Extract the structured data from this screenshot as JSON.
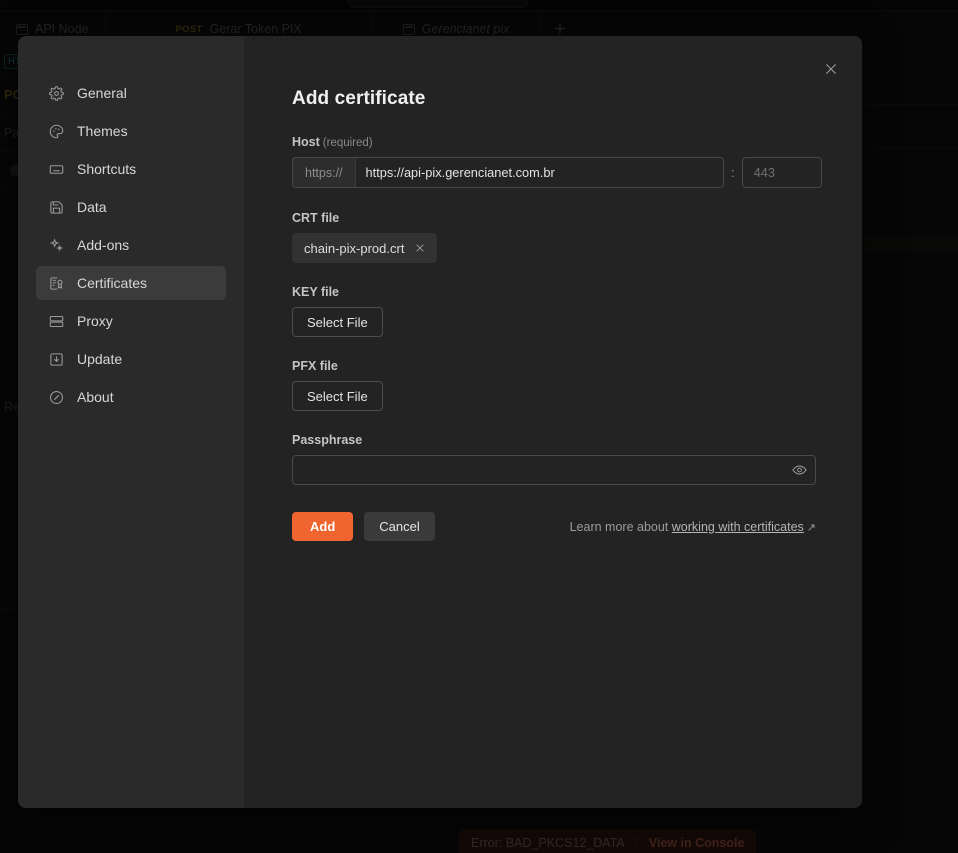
{
  "background": {
    "tabs": [
      {
        "label": "API Node",
        "method": "",
        "icon": "node-icon",
        "italic": false
      },
      {
        "label": "Gerar Token PIX",
        "method": "POST",
        "icon": "",
        "italic": false
      },
      {
        "label": "Gerencianet pix",
        "method": "",
        "icon": "node-icon",
        "italic": true
      }
    ],
    "new_tab_label": "+",
    "left_rows": [
      {
        "text": "HTTP",
        "kind": "badge"
      },
      {
        "text": "PO",
        "kind": "post"
      },
      {
        "text": "Para",
        "kind": "plain"
      },
      {
        "text": "",
        "kind": "dot"
      },
      {
        "text": "Res",
        "kind": "plain"
      }
    ],
    "toast": {
      "message": "Error: BAD_PKCS12_DATA",
      "action_label": "View in Console"
    }
  },
  "modal": {
    "title": "Add certificate",
    "close_label": "×",
    "sidebar": {
      "items": [
        {
          "label": "General",
          "icon": "gear-icon",
          "active": false
        },
        {
          "label": "Themes",
          "icon": "palette-icon",
          "active": false
        },
        {
          "label": "Shortcuts",
          "icon": "keyboard-icon",
          "active": false
        },
        {
          "label": "Data",
          "icon": "save-disk-icon",
          "active": false
        },
        {
          "label": "Add-ons",
          "icon": "sparkles-icon",
          "active": false
        },
        {
          "label": "Certificates",
          "icon": "certificate-icon",
          "active": true
        },
        {
          "label": "Proxy",
          "icon": "server-icon",
          "active": false
        },
        {
          "label": "Update",
          "icon": "download-box-icon",
          "active": false
        },
        {
          "label": "About",
          "icon": "info-circle-icon",
          "active": false
        }
      ]
    },
    "form": {
      "host": {
        "label": "Host",
        "required_note": "(required)",
        "protocol": "https://",
        "value": "https://api-pix.gerencianet.com.br",
        "placeholder": "",
        "separator": ":",
        "port_value": "",
        "port_placeholder": "443"
      },
      "crt": {
        "label": "CRT file",
        "file_name": "chain-pix-prod.crt",
        "remove_label": "×"
      },
      "key": {
        "label": "KEY file",
        "button_label": "Select File"
      },
      "pfx": {
        "label": "PFX file",
        "button_label": "Select File"
      },
      "passphrase": {
        "label": "Passphrase",
        "value": "",
        "placeholder": "",
        "toggle_label": "eye-icon"
      },
      "actions": {
        "submit_label": "Add",
        "cancel_label": "Cancel",
        "help_prefix": "Learn more about",
        "help_link": "working with certificates",
        "help_external_glyph": "↗"
      }
    }
  },
  "colors": {
    "accent": "#f0652f",
    "modal_bg": "#232323",
    "sidebar_bg": "#2a2a2a",
    "active_item_bg": "#3b3b3b",
    "toast_bg": "#2a1410",
    "page_bg": "#0c0c0c"
  }
}
